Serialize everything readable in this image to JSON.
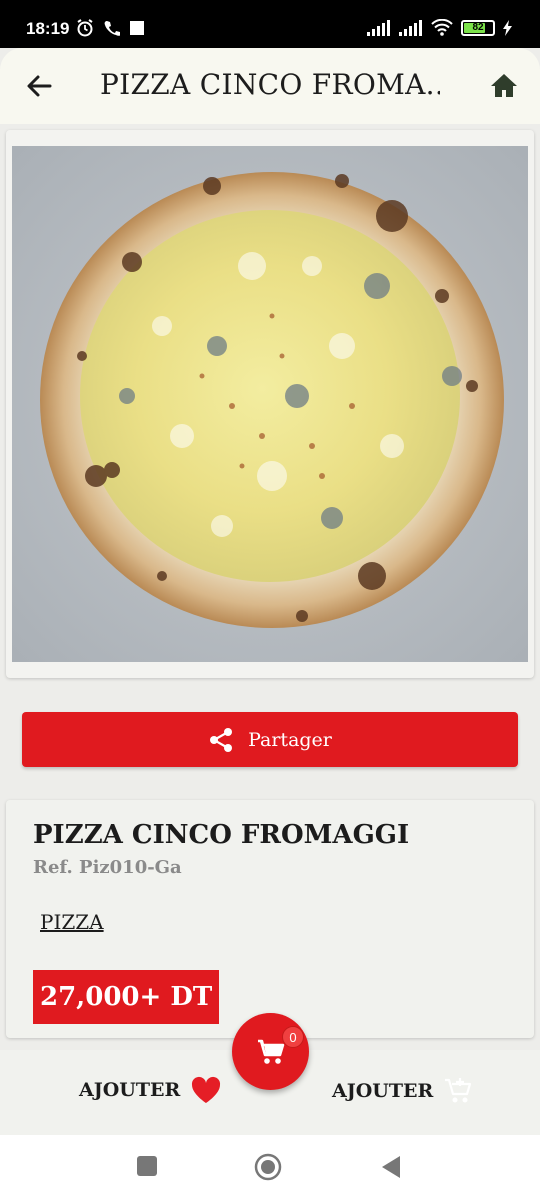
{
  "status_bar": {
    "time": "18:19",
    "battery": "82",
    "icons_left": [
      "alarm-icon",
      "phone-icon",
      "square-icon"
    ],
    "icons_right": [
      "signal-icon",
      "signal-icon",
      "wifi-icon",
      "battery-icon",
      "charging-icon"
    ]
  },
  "app_bar": {
    "title": "PIZZA CINCO FROMA...",
    "back_icon": "arrow-left-icon",
    "home_icon": "home-icon"
  },
  "product": {
    "image": "pizza-photo",
    "share_label": "Partager",
    "name": "PIZZA CINCO FROMAGGI",
    "ref": "Ref. Piz010-Ga",
    "category": "PIZZA",
    "price": "27,000+ DT"
  },
  "cart": {
    "count": "0"
  },
  "actions": {
    "favorite_label": "AJOUTER",
    "add_cart_label": "AJOUTER"
  },
  "colors": {
    "accent": "#e01a1f",
    "background": "#ededea"
  }
}
